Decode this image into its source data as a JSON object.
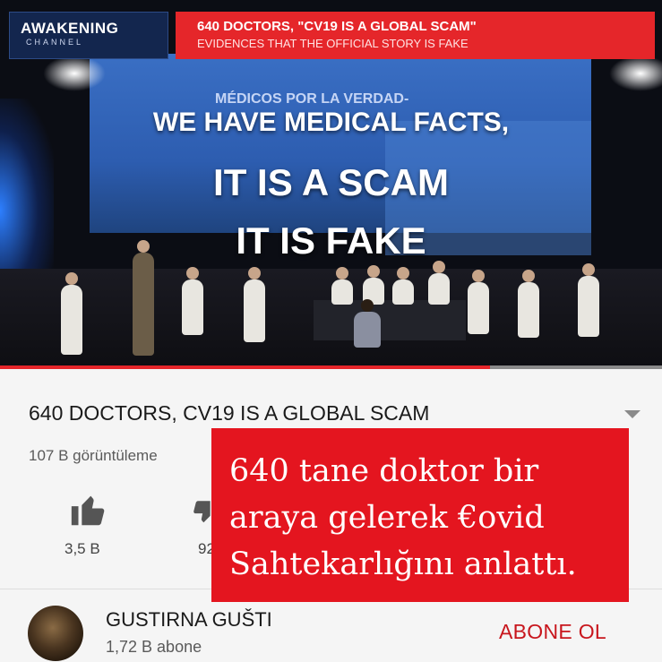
{
  "video": {
    "logo_text": "AWAKENING",
    "logo_sub": "CHANNEL",
    "banner_line1": "640 DOCTORS,  \"CV19 IS A GLOBAL SCAM\"",
    "banner_line2": "EVIDENCES THAT THE OFFICIAL STORY IS FAKE",
    "screen_caption": "MÉDICOS POR LA VERDAD-",
    "overlay_line1": "WE HAVE MEDICAL FACTS,",
    "overlay_line2": "IT IS A SCAM",
    "overlay_line3": "IT IS FAKE",
    "progress_fraction": 0.74
  },
  "info": {
    "title": "640 DOCTORS, CV19 IS A GLOBAL SCAM",
    "views": "107 B görüntüleme",
    "like_count": "3,5 B",
    "dislike_count": "92"
  },
  "channel": {
    "name": "GUSTIRNA GUŠTI",
    "subscribers": "1,72 B abone",
    "subscribe_label": "ABONE OL"
  },
  "note": {
    "text_line1": "640 tane doktor bir",
    "text_line2": "araya gelerek €ovid",
    "text_line3": "Sahtekarlığını anlattı."
  },
  "colors": {
    "accent_red": "#e4151f",
    "subscribe_red": "#c8161d"
  }
}
